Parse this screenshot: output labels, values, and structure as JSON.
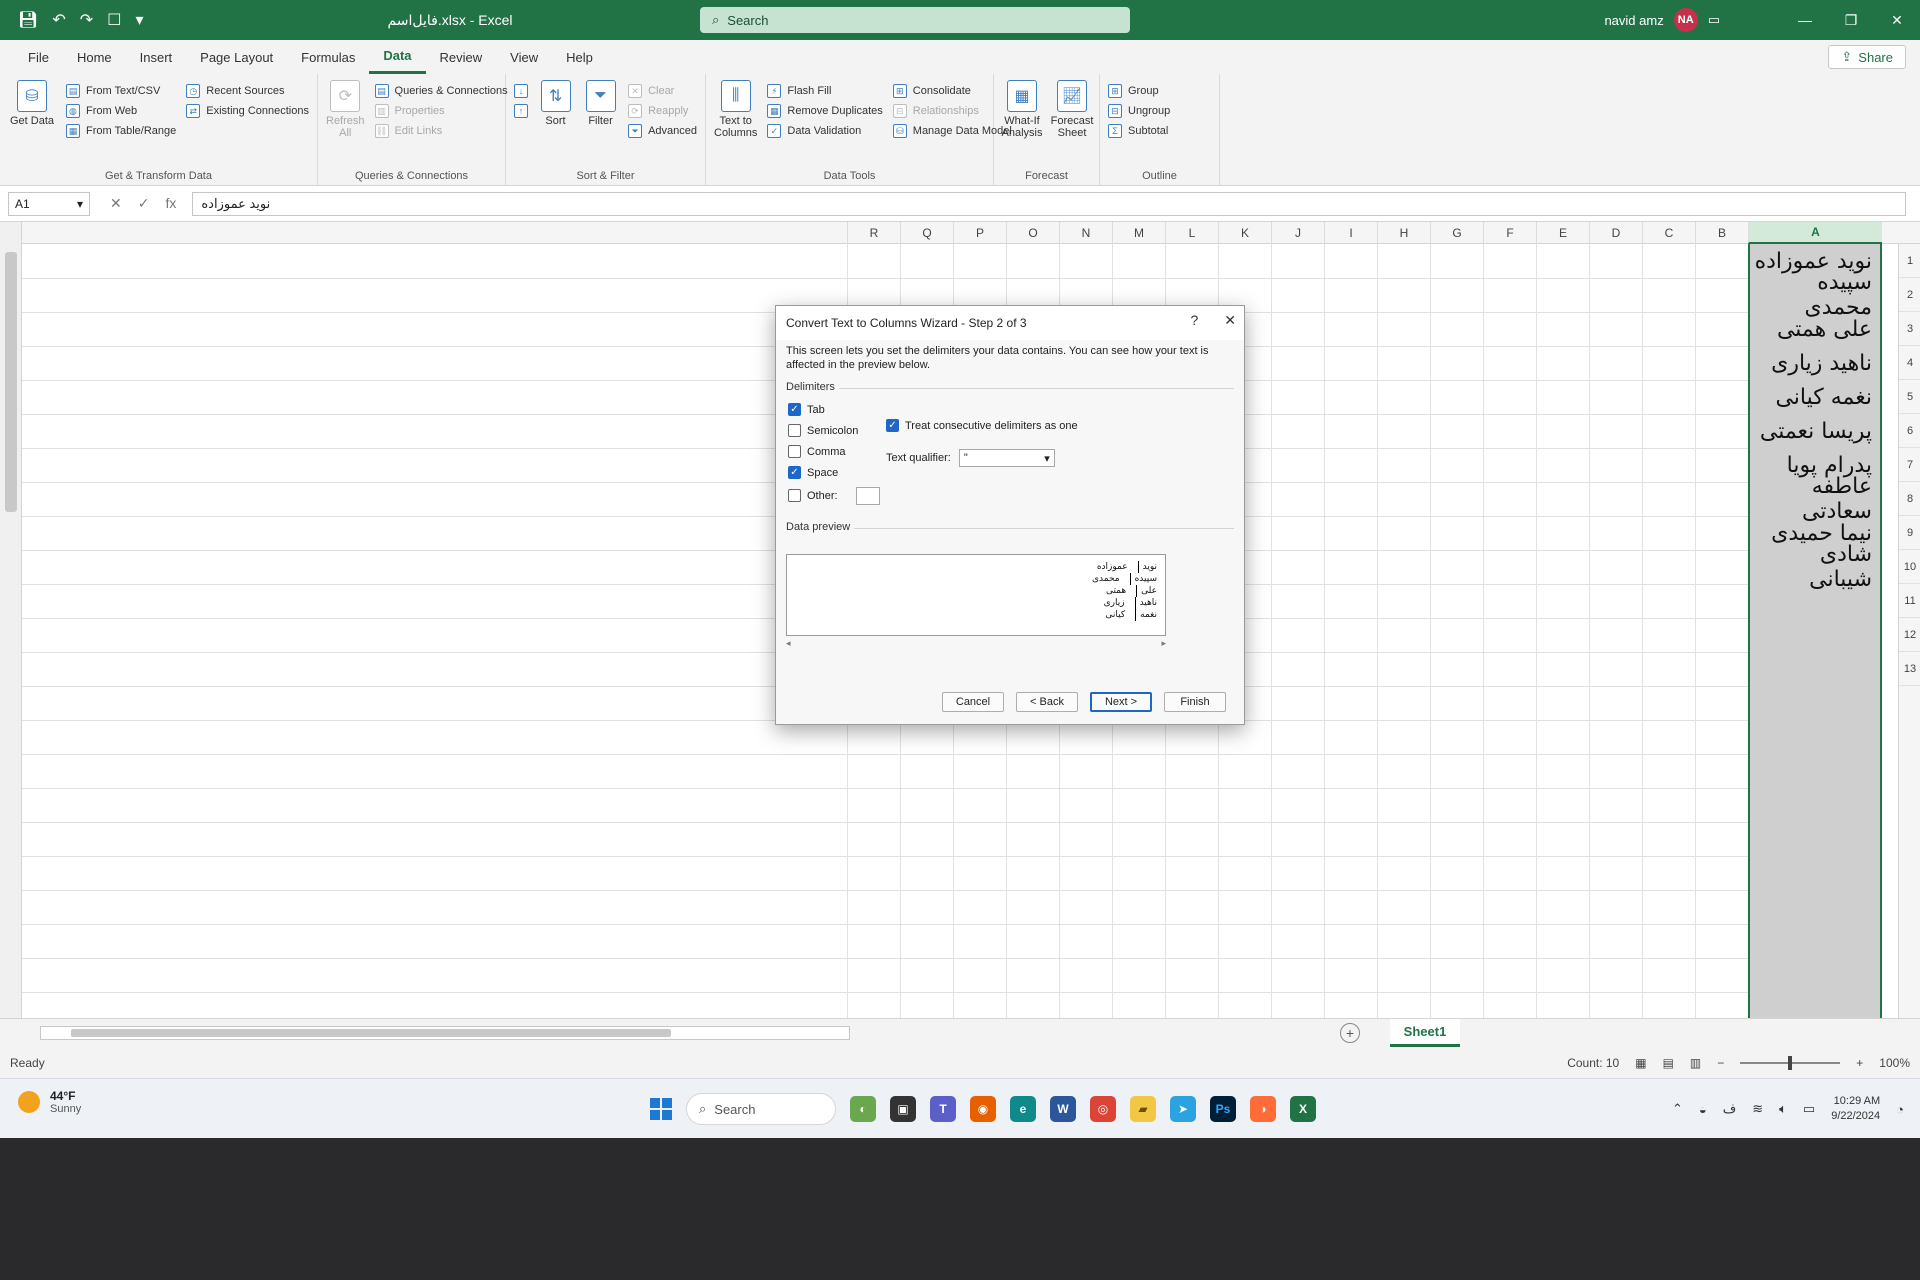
{
  "app": {
    "doc_title": "فایل‌اسم.xlsx - Excel",
    "search_placeholder": "Search",
    "user_name": "navid amz",
    "user_initials": "NA"
  },
  "tabs": [
    "File",
    "Home",
    "Insert",
    "Page Layout",
    "Formulas",
    "Data",
    "Review",
    "View",
    "Help"
  ],
  "active_tab": "Data",
  "share_label": "Share",
  "ribbon": {
    "get_data": "Get Data",
    "from_text_csv": "From Text/CSV",
    "from_web": "From Web",
    "from_table": "From Table/Range",
    "recent_sources": "Recent Sources",
    "existing_connections": "Existing Connections",
    "group_get_transform": "Get & Transform Data",
    "refresh_all": "Refresh All",
    "queries_connections": "Queries & Connections",
    "properties": "Properties",
    "edit_links": "Edit Links",
    "group_queries": "Queries & Connections",
    "sort": "Sort",
    "filter": "Filter",
    "clear": "Clear",
    "reapply": "Reapply",
    "advanced": "Advanced",
    "group_sort_filter": "Sort & Filter",
    "text_to_columns": "Text to Columns",
    "flash_fill": "Flash Fill",
    "remove_duplicates": "Remove Duplicates",
    "data_validation": "Data Validation",
    "consolidate": "Consolidate",
    "relationships": "Relationships",
    "manage_data_model": "Manage Data Model",
    "group_data_tools": "Data Tools",
    "what_if": "What-If Analysis",
    "forecast_sheet": "Forecast Sheet",
    "group_forecast": "Forecast",
    "group_btn": "Group",
    "ungroup_btn": "Ungroup",
    "subtotal": "Subtotal",
    "group_outline": "Outline"
  },
  "formula_bar": {
    "name_box": "A1",
    "fx": "fx",
    "content": "نوید عموزاده"
  },
  "columns": [
    "R",
    "Q",
    "P",
    "O",
    "N",
    "M",
    "L",
    "K",
    "J",
    "I",
    "H",
    "G",
    "F",
    "E",
    "D",
    "C",
    "B",
    "A"
  ],
  "selected_column": "A",
  "cells_a": [
    "نوید عموزاده",
    "سپیده محمدی",
    "علی همتی",
    "ناهید زیاری",
    "نغمه کیانی",
    "پریسا نعمتی",
    "پدرام پویا",
    "عاطفه سعادتی",
    "نیما حمیدی",
    "شادی شیبانی"
  ],
  "row_numbers": [
    "1",
    "2",
    "3",
    "4",
    "5",
    "6",
    "7",
    "8",
    "9",
    "10",
    "11",
    "12",
    "13"
  ],
  "sheet_tab": "Sheet1",
  "status": {
    "ready": "Ready",
    "count": "Count: 10",
    "zoom": "100%"
  },
  "dialog": {
    "title": "Convert Text to Columns Wizard - Step 2 of 3",
    "help": "?",
    "close": "✕",
    "description": "This screen lets you set the delimiters your data contains. You can see how your text is affected in the preview below.",
    "delimiters_label": "Delimiters",
    "delimiters": [
      {
        "label": "Tab",
        "checked": true
      },
      {
        "label": "Semicolon",
        "checked": false
      },
      {
        "label": "Comma",
        "checked": false
      },
      {
        "label": "Space",
        "checked": true
      },
      {
        "label": "Other:",
        "checked": false
      }
    ],
    "consecutive_label": "Treat consecutive delimiters as one",
    "consecutive_checked": true,
    "text_qualifier_label": "Text qualifier:",
    "text_qualifier_value": "\"",
    "data_preview_label": "Data preview",
    "preview_rows": [
      [
        "نوید",
        "عموزاده"
      ],
      [
        "سپیده",
        "محمدی"
      ],
      [
        "علی",
        "همتی"
      ],
      [
        "ناهید",
        "زیاری"
      ],
      [
        "نغمه",
        "کیانی"
      ]
    ],
    "buttons": {
      "cancel": "Cancel",
      "back": "< Back",
      "next": "Next >",
      "finish": "Finish"
    }
  },
  "taskbar": {
    "temp": "44°F",
    "weather": "Sunny",
    "search": "Search",
    "time": "10:29 AM",
    "date": "9/22/2024"
  }
}
